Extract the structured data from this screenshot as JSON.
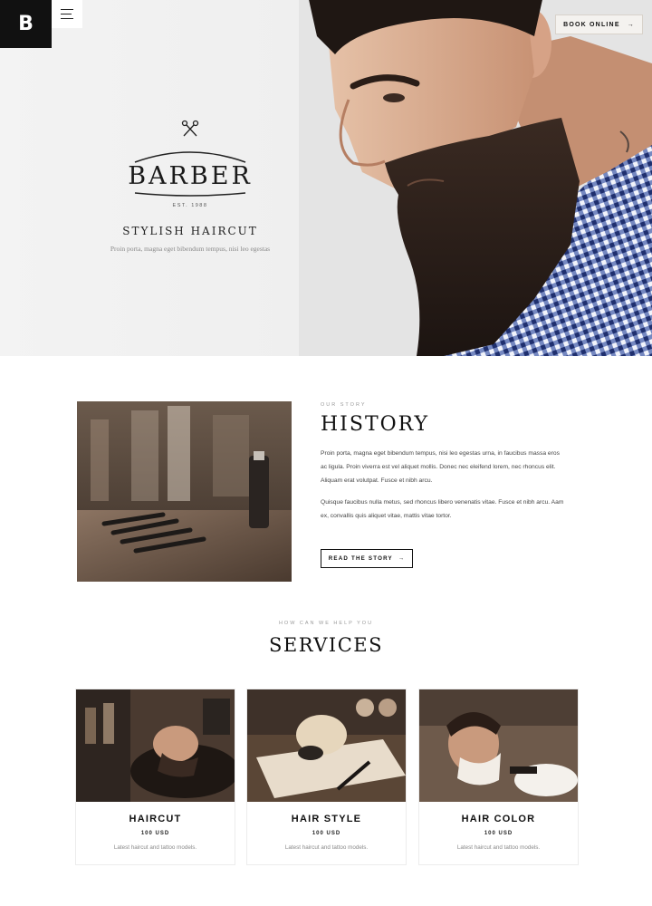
{
  "header": {
    "logo_letter": "B",
    "book_label": "BOOK ONLINE",
    "book_arrow": "→"
  },
  "hero": {
    "brand_name": "BARBER",
    "est": "EST. 1988",
    "title": "STYLISH HAIRCUT",
    "subtitle": "Proin porta, magna eget bibendum tempus, nisi leo egestas",
    "icons": [
      "menu-icon",
      "scissors-icon",
      "arrow-right-icon"
    ]
  },
  "history": {
    "eyebrow": "OUR STORY",
    "title": "HISTORY",
    "para1": "Proin porta, magna eget bibendum tempus, nisi leo egestas urna, in faucibus massa eros ac ligula. Proin viverra est vel aliquet mollis. Donec nec eleifend lorem, nec rhoncus elit. Aliquam erat volutpat. Fusce et nibh arcu.",
    "para2": "Quisque faucibus nulla metus, sed rhoncus libero venenatis vitae. Fusce et nibh arcu. Aam ex, convallis quis aliquet vitae, mattis vitae tortor.",
    "button_label": "READ THE STORY",
    "button_arrow": "→"
  },
  "services": {
    "eyebrow": "HOW CAN WE HELP YOU",
    "title": "SERVICES",
    "items": [
      {
        "name": "HAIRCUT",
        "price": "100 USD",
        "desc": "Latest haircut and tattoo models."
      },
      {
        "name": "HAIR STYLE",
        "price": "100 USD",
        "desc": "Latest haircut and tattoo models."
      },
      {
        "name": "HAIR COLOR",
        "price": "100 USD",
        "desc": "Latest haircut and tattoo models."
      }
    ]
  },
  "colors": {
    "ink": "#111111",
    "muted": "#8a8a8a",
    "hero_bg": "#efefef",
    "beard": "#2a1d17",
    "shirt_blue": "#2f4f9a"
  }
}
